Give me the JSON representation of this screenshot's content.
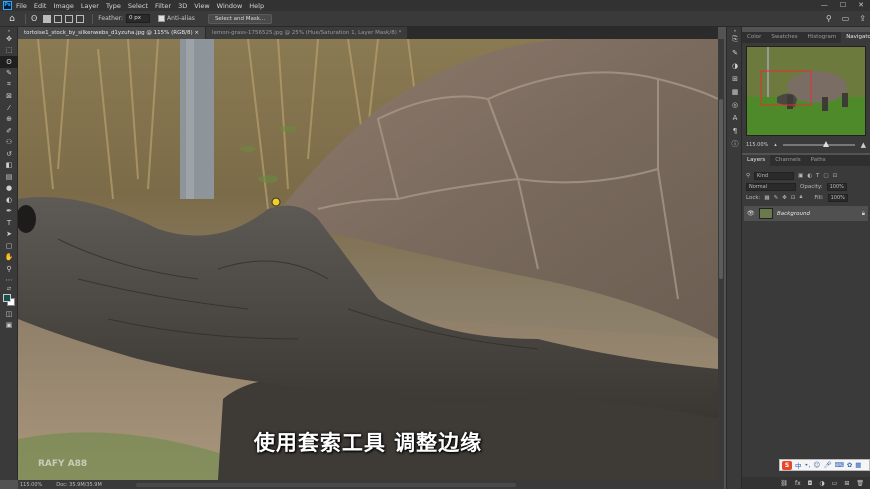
{
  "menubar": {
    "app_icon": "Ps",
    "items": [
      "File",
      "Edit",
      "Image",
      "Layer",
      "Type",
      "Select",
      "Filter",
      "3D",
      "View",
      "Window",
      "Help"
    ],
    "window_controls": [
      "—",
      "☐",
      "✕"
    ]
  },
  "options": {
    "feather_label": "Feather:",
    "feather_value": "0 px",
    "antialias_label": "Anti-alias",
    "select_mask_label": "Select and Mask..."
  },
  "tabs": [
    {
      "label": "tortoise1_stock_by_silkenwebs_d1yzuha.jpg @ 115% (RGB/8) ×",
      "active": true
    },
    {
      "label": "lemon-grass-1756525.jpg @ 25% (Hue/Saturation 1, Layer Mask/8) *",
      "active": false
    }
  ],
  "canvas": {
    "subtitle": "使用套索工具 调整边缘",
    "watermark": "RAFY A88"
  },
  "status": {
    "zoom": "115.00%",
    "doc": "Doc: 35.9M/35.9M"
  },
  "navigator": {
    "tabs": [
      "Color",
      "Swatches",
      "Histogram",
      "Navigator"
    ],
    "active_tab": "Navigator",
    "zoom": "115.00%"
  },
  "layers": {
    "tabs": [
      "Layers",
      "Channels",
      "Paths"
    ],
    "active_tab": "Layers",
    "filter_label": "Kind",
    "blend_mode": "Normal",
    "opacity_label": "Opacity:",
    "opacity_value": "100%",
    "lock_label": "Lock:",
    "fill_label": "Fill:",
    "fill_value": "100%",
    "items": [
      {
        "name": "Background"
      }
    ]
  },
  "ime": {
    "logo": "S",
    "lang": "中"
  }
}
